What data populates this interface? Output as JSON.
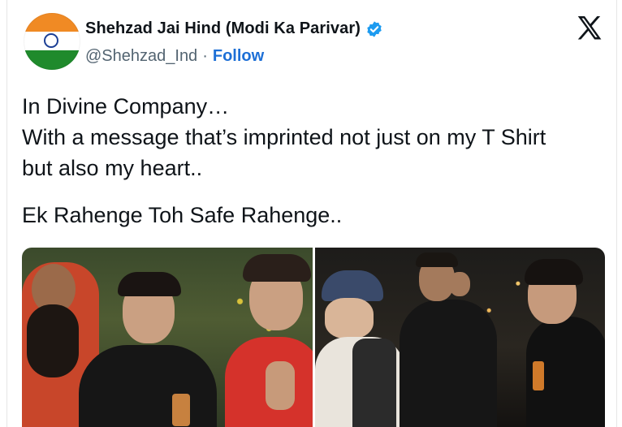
{
  "author": {
    "display_name": "Shehzad Jai Hind (Modi Ka Parivar)",
    "handle": "@Shehzad_Ind",
    "separator": "·",
    "follow_label": "Follow",
    "verified_color": "#1d9bf0"
  },
  "platform": {
    "logo": "x-logo"
  },
  "tweet": {
    "lines": [
      "In Divine Company…",
      "With a message that’s imprinted not just on my T Shirt",
      "but also my heart..",
      "Ek Rahenge Toh Safe Rahenge.."
    ]
  },
  "media": {
    "photos": [
      "photo-left",
      "photo-right"
    ]
  },
  "colors": {
    "text": "#0f1419",
    "secondary": "#536471",
    "follow": "#1d6fd6"
  }
}
